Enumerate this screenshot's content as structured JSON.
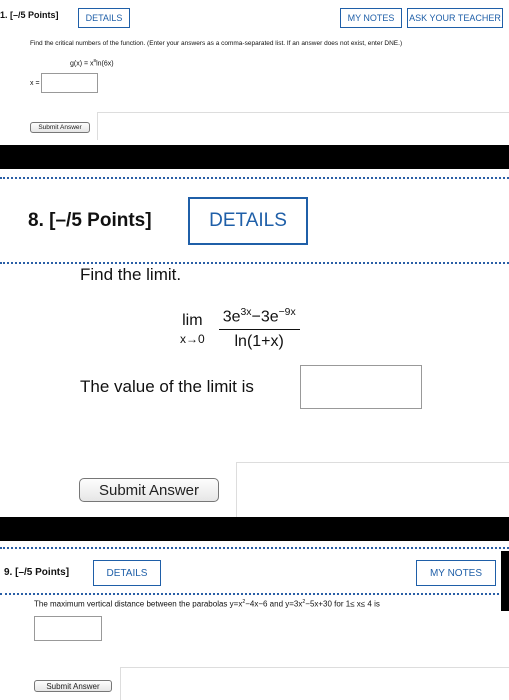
{
  "q1": {
    "number": "1.",
    "points": "[–/5 Points]",
    "details_label": "DETAILS",
    "my_notes_label": "MY NOTES",
    "ask_teacher_label": "ASK YOUR TEACHER",
    "prompt": "Find the critical numbers of the function. (Enter your answers as a comma-separated list. If an answer does not exist, enter DNE.)",
    "function_lhs": "g(x) = x",
    "function_exp": "8",
    "function_rhs": "ln(6x)",
    "answer_label": "x =",
    "submit_label": "Submit Answer"
  },
  "q8": {
    "number": "8.",
    "points": "[–/5 Points]",
    "details_label": "DETAILS",
    "prompt": "Find the limit.",
    "lim_word": "lim",
    "lim_sub": "x→0",
    "num_a": "3e",
    "num_a_exp": "3x",
    "num_b": "−3e",
    "num_b_exp": "−9x",
    "denominator": "ln(1+x)",
    "answer_label": "The value of the limit is",
    "submit_label": "Submit Answer"
  },
  "q9": {
    "number": "9.",
    "points": "[–/5 Points]",
    "details_label": "DETAILS",
    "my_notes_label": "MY NOTES",
    "prompt_a": "The maximum vertical distance between the parabolas y=x",
    "exp_2a": "2",
    "prompt_b": "−4x−6 and y=3x",
    "exp_2b": "2",
    "prompt_c": "−5x+30 for 1≤ x≤ 4 is",
    "submit_label": "Submit Answer"
  }
}
